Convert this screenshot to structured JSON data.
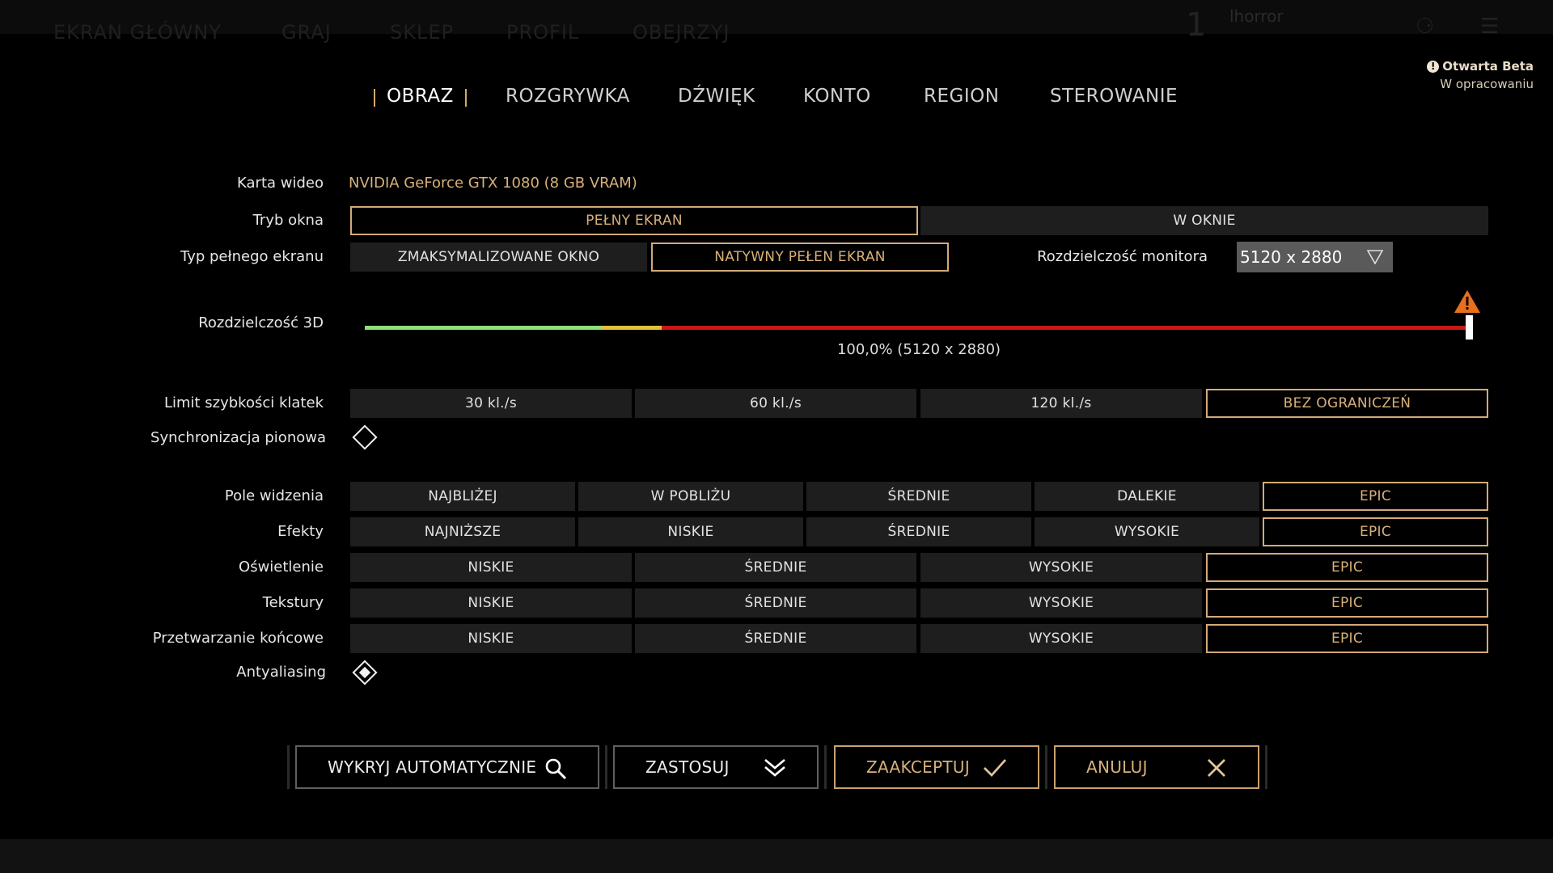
{
  "background_nav": {
    "items": [
      "EKRAN GŁÓWNY",
      "GRAJ",
      "SKLEP",
      "PROFIL",
      "OBEJRZYJ"
    ],
    "profile_number": "1",
    "profile_name": "lhorror"
  },
  "beta_badge": {
    "title": "Otwarta Beta",
    "subtitle": "W opracowaniu"
  },
  "tabs": [
    {
      "label": "OBRAZ",
      "active": true
    },
    {
      "label": "ROZGRYWKA",
      "active": false
    },
    {
      "label": "DŹWIĘK",
      "active": false
    },
    {
      "label": "KONTO",
      "active": false
    },
    {
      "label": "REGION",
      "active": false
    },
    {
      "label": "STEROWANIE",
      "active": false
    }
  ],
  "settings": {
    "video_card": {
      "label": "Karta wideo",
      "value": "NVIDIA GeForce GTX 1080 (8 GB VRAM)"
    },
    "window_mode": {
      "label": "Tryb okna",
      "options": [
        "PEŁNY EKRAN",
        "W OKNIE"
      ],
      "selected": "PEŁNY EKRAN"
    },
    "fullscreen_type": {
      "label": "Typ pełnego ekranu",
      "options": [
        "ZMAKSYMALIZOWANE OKNO",
        "NATYWNY PEŁEN EKRAN"
      ],
      "selected": "NATYWNY PEŁEN EKRAN"
    },
    "monitor_resolution": {
      "label": "Rozdzielczość monitora",
      "value": "5120 x 2880"
    },
    "render_scale": {
      "label": "Rozdzielczość 3D",
      "value_text": "100,0% (5120 x 2880)",
      "percent": 100
    },
    "frame_limit": {
      "label": "Limit szybkości klatek",
      "options": [
        "30 kl./s",
        "60 kl./s",
        "120 kl./s",
        "BEZ OGRANICZEŃ"
      ],
      "selected": "BEZ OGRANICZEŃ"
    },
    "vsync": {
      "label": "Synchronizacja pionowa",
      "checked": false
    },
    "view_distance": {
      "label": "Pole widzenia",
      "options": [
        "NAJBLIŻEJ",
        "W POBLIŻU",
        "ŚREDNIE",
        "DALEKIE",
        "EPIC"
      ],
      "selected": "EPIC"
    },
    "effects": {
      "label": "Efekty",
      "options": [
        "NAJNIŻSZE",
        "NISKIE",
        "ŚREDNIE",
        "WYSOKIE",
        "EPIC"
      ],
      "selected": "EPIC"
    },
    "lighting": {
      "label": "Oświetlenie",
      "options": [
        "NISKIE",
        "ŚREDNIE",
        "WYSOKIE",
        "EPIC"
      ],
      "selected": "EPIC"
    },
    "textures": {
      "label": "Tekstury",
      "options": [
        "NISKIE",
        "ŚREDNIE",
        "WYSOKIE",
        "EPIC"
      ],
      "selected": "EPIC"
    },
    "post_processing": {
      "label": "Przetwarzanie końcowe",
      "options": [
        "NISKIE",
        "ŚREDNIE",
        "WYSOKIE",
        "EPIC"
      ],
      "selected": "EPIC"
    },
    "antialiasing": {
      "label": "Antyaliasing",
      "checked": true
    }
  },
  "buttons": {
    "auto_detect": "WYKRYJ AUTOMATYCZNIE",
    "apply": "ZASTOSUJ",
    "accept": "ZAAKCEPTUJ",
    "cancel": "ANULUJ"
  },
  "colors": {
    "accent_gold": "#d3aa78",
    "slider_green": "#8ee07a",
    "slider_yellow": "#e0c23a",
    "slider_red": "#c81717",
    "warning_orange": "#e8701c"
  }
}
